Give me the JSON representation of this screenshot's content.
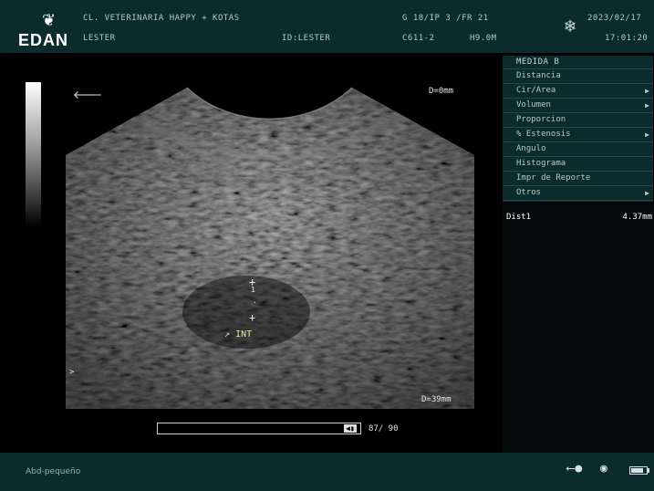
{
  "header": {
    "logo_text": "EDAN",
    "clinic": "CL. VETERINARIA HAPPY + KOTAS",
    "patient": "LESTER",
    "patient_id": "ID:LESTER",
    "params": "G 18/IP 3 /FR 21",
    "probe": "C611-2",
    "frequency": "H9.0M",
    "date": "2023/02/17",
    "time": "17:01:20",
    "freeze_icon": "snowflake-icon"
  },
  "image": {
    "depth_top": "D=0mm",
    "depth_bottom": "D=39mm",
    "caliper_index": "1",
    "annotation": "INT",
    "orientation_marker": ">",
    "frame_counter": "87/ 90",
    "cine_position": 0.967
  },
  "menu": {
    "title": "MEDIDA B",
    "items": [
      {
        "label": "Distancia",
        "submenu": false
      },
      {
        "label": "Cir/Area",
        "submenu": true
      },
      {
        "label": "Volumen",
        "submenu": true
      },
      {
        "label": "Proporcion",
        "submenu": false
      },
      {
        "label": "% Estenosis",
        "submenu": true
      },
      {
        "label": "Angulo",
        "submenu": false
      },
      {
        "label": "Histograma",
        "submenu": false
      },
      {
        "label": "Impr de Reporte",
        "submenu": false
      },
      {
        "label": "Otros",
        "submenu": true
      }
    ]
  },
  "results": {
    "label": "Dist1",
    "value": "4.37mm"
  },
  "footer": {
    "preset": "Abd-pequeño",
    "icons": [
      "usb-icon",
      "probe-icon",
      "battery-icon"
    ],
    "battery_level": 0.8
  },
  "colors": {
    "panel": "#0c2b2c",
    "annotation": "#e6e6a8"
  }
}
